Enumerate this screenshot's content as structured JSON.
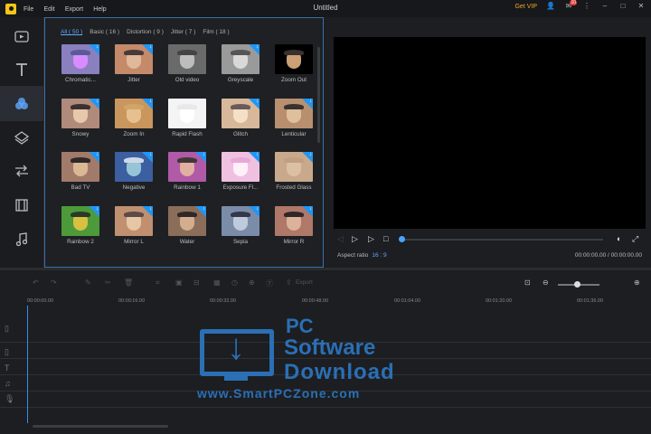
{
  "app": {
    "title": "Untitled",
    "menu": [
      "File",
      "Edit",
      "Export",
      "Help"
    ],
    "get_vip": "Get VIP",
    "notification_count": "10"
  },
  "colors": {
    "accent": "#4aa3ff",
    "vip": "#f5a623",
    "download_badge": "#2196f3",
    "panel_border": "#3b6fa8"
  },
  "sidebar": {
    "items": [
      {
        "icon": "media-icon",
        "active": false
      },
      {
        "icon": "text-icon",
        "active": false
      },
      {
        "icon": "filters-icon",
        "active": true
      },
      {
        "icon": "overlays-icon",
        "active": false
      },
      {
        "icon": "transitions-icon",
        "active": false
      },
      {
        "icon": "elements-icon",
        "active": false
      },
      {
        "icon": "music-icon",
        "active": false
      }
    ]
  },
  "filters": {
    "tabs": [
      "All ( 50 )",
      "Basic ( 16 )",
      "Distortion ( 9 )",
      "Jitter ( 7 )",
      "Film ( 18 )"
    ],
    "selected_tab": "All ( 50 )",
    "items": [
      {
        "label": "Chromatic...",
        "bg": "#8a7fbf",
        "dog": "#d88cff",
        "hat": "#5a5a9a",
        "download": true
      },
      {
        "label": "Jitter",
        "bg": "#c58a6a",
        "dog": "#e0b89a",
        "hat": "#4a3a3a",
        "download": true
      },
      {
        "label": "Old video",
        "bg": "#6a6a6a",
        "dog": "#bdbdbd",
        "hat": "#444",
        "download": false
      },
      {
        "label": "Greyscale",
        "bg": "#9a9a9a",
        "dog": "#d8d8d8",
        "hat": "#555",
        "download": true
      },
      {
        "label": "Zoom Out",
        "bg": "#000000",
        "dog": "#caa074",
        "hat": "#3a3030",
        "download": false
      },
      {
        "label": "Snowy",
        "bg": "#b08a7a",
        "dog": "#e8c8aa",
        "hat": "#3a3030",
        "download": true
      },
      {
        "label": "Zoom In",
        "bg": "#c9965d",
        "dog": "#e6c18f",
        "hat": "#d1a56a",
        "download": true
      },
      {
        "label": "Rapid Flash",
        "bg": "#f4f4f4",
        "dog": "#ffffff",
        "hat": "#e8e8e8",
        "download": false
      },
      {
        "label": "Glitch",
        "bg": "#d7b89a",
        "dog": "#f3e0c6",
        "hat": "#6a5a5a",
        "download": true
      },
      {
        "label": "Lenticular",
        "bg": "#b89070",
        "dog": "#dfc09a",
        "hat": "#3a3030",
        "download": true
      },
      {
        "label": "Bad TV",
        "bg": "#a27a6a",
        "dog": "#dbb894",
        "hat": "#302828",
        "download": true
      },
      {
        "label": "Negative",
        "bg": "#3b5fa0",
        "dog": "#98c4d8",
        "hat": "#cfd8e8",
        "download": true
      },
      {
        "label": "Rainbow 1",
        "bg": "#b05aa8",
        "dog": "#e1b0a0",
        "hat": "#403838",
        "download": true
      },
      {
        "label": "Exposure Fl...",
        "bg": "#f0c0e0",
        "dog": "#fff0f8",
        "hat": "#e8a8d8",
        "download": true
      },
      {
        "label": "Frosted Glass",
        "bg": "#c9a98b",
        "dog": "#dcc0a4",
        "hat": "#c0a080",
        "download": true
      },
      {
        "label": "Rainbow 2",
        "bg": "#4c9a3a",
        "dog": "#d8c040",
        "hat": "#2a3a2a",
        "download": true
      },
      {
        "label": "Mirror L",
        "bg": "#c09070",
        "dog": "#e6c6a4",
        "hat": "#5a4a4a",
        "download": true
      },
      {
        "label": "Water",
        "bg": "#8a6e5a",
        "dog": "#d2ae8e",
        "hat": "#2f2828",
        "download": true
      },
      {
        "label": "Sepia",
        "bg": "#7a8ca8",
        "dog": "#bfcadc",
        "hat": "#30384a",
        "download": true
      },
      {
        "label": "Mirror R",
        "bg": "#b07868",
        "dog": "#dcb39a",
        "hat": "#302828",
        "download": true
      }
    ]
  },
  "player": {
    "aspect_ratio_label": "Aspect ratio",
    "aspect_ratio_value": "16 : 9",
    "time_display": "00:00:00.00 / 00:00:00.00"
  },
  "timeline": {
    "export_label": "Export",
    "ruler": [
      "00:00:00.00",
      "00:00:16.00",
      "00:00:32.00",
      "00:00:48.00",
      "00:01:04.00",
      "00:01:20.00",
      "00:01:36.00"
    ]
  },
  "watermark": {
    "line1": "PC",
    "line2": "Software",
    "line3": "Download",
    "line4": "www.SmartPCZone.com"
  }
}
